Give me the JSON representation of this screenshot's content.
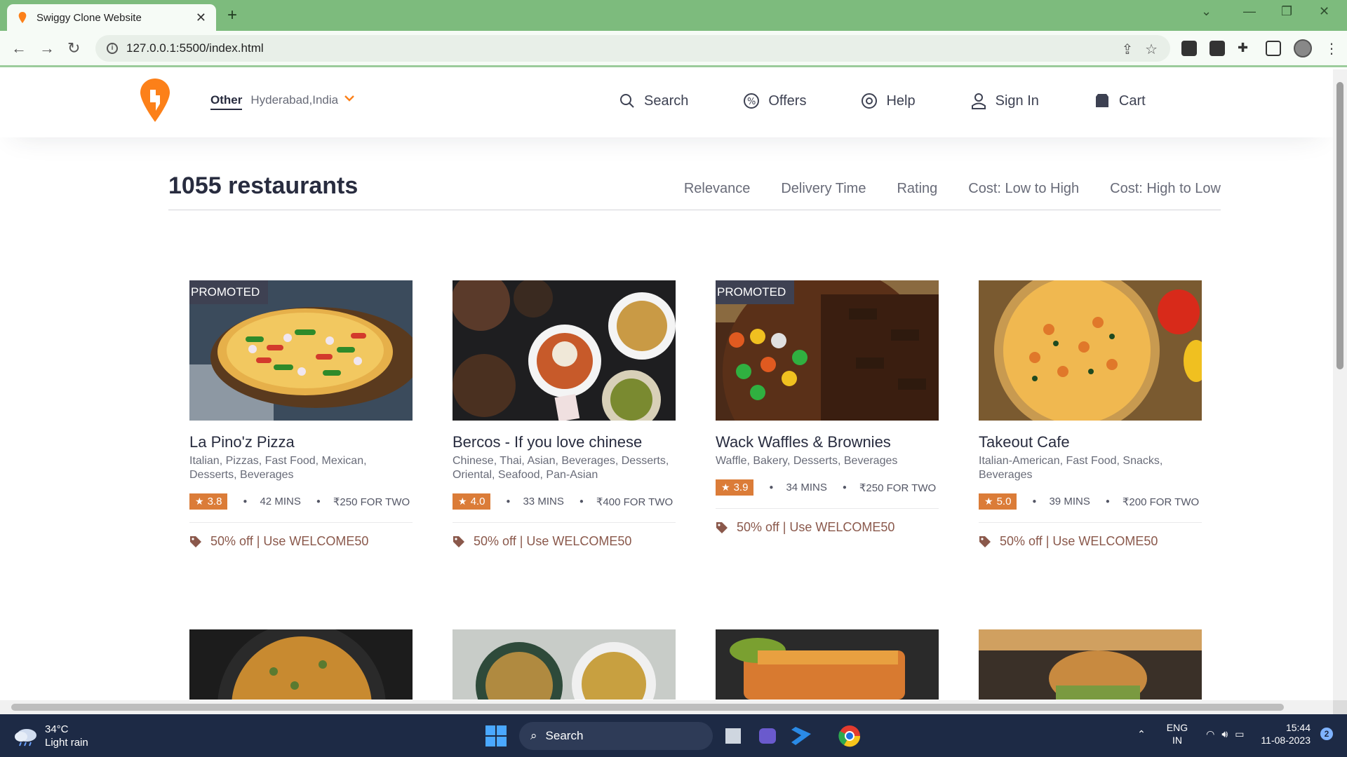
{
  "browser": {
    "tab_title": "Swiggy Clone Website",
    "url": "127.0.0.1:5500/index.html"
  },
  "header": {
    "location_type": "Other",
    "location_city": "Hyderabad,India",
    "nav": [
      {
        "label": "Search",
        "icon": "search-icon"
      },
      {
        "label": "Offers",
        "icon": "offers-icon"
      },
      {
        "label": "Help",
        "icon": "help-icon"
      },
      {
        "label": "Sign In",
        "icon": "user-icon"
      },
      {
        "label": "Cart",
        "icon": "cart-icon"
      }
    ]
  },
  "listing": {
    "count_text": "1055 restaurants",
    "sorts": [
      "Relevance",
      "Delivery Time",
      "Rating",
      "Cost: Low to High",
      "Cost: High to Low"
    ]
  },
  "restaurants": [
    {
      "name": "La Pino'z Pizza",
      "cuisine": "Italian, Pizzas, Fast Food, Mexican, Desserts, Beverages",
      "rating": "3.8",
      "time": "42 MINS",
      "cost": "₹250 FOR TWO",
      "offer": "50% off | Use WELCOME50",
      "promoted": "PROMOTED"
    },
    {
      "name": "Bercos - If you love chinese",
      "cuisine": "Chinese, Thai, Asian, Beverages, Desserts, Oriental, Seafood, Pan-Asian",
      "rating": "4.0",
      "time": "33 MINS",
      "cost": "₹400 FOR TWO",
      "offer": "50% off | Use WELCOME50"
    },
    {
      "name": "Wack Waffles & Brownies",
      "cuisine": "Waffle, Bakery, Desserts, Beverages",
      "rating": "3.9",
      "time": "34 MINS",
      "cost": "₹250 FOR TWO",
      "offer": "50% off | Use WELCOME50",
      "promoted": "PROMOTED"
    },
    {
      "name": "Takeout Cafe",
      "cuisine": "Italian-American, Fast Food, Snacks, Beverages",
      "rating": "5.0",
      "time": "39 MINS",
      "cost": "₹200 FOR TWO",
      "offer": "50% off | Use WELCOME50"
    }
  ],
  "taskbar": {
    "temp": "34°C",
    "weather": "Light rain",
    "search": "Search",
    "lang1": "ENG",
    "lang2": "IN",
    "time": "15:44",
    "date": "11-08-2023",
    "notif": "2"
  },
  "colors": {
    "brand": "#fc8019",
    "rating_bg": "#db7c38",
    "offer_text": "#8a584b",
    "chrome_green": "#7dbb7d"
  }
}
